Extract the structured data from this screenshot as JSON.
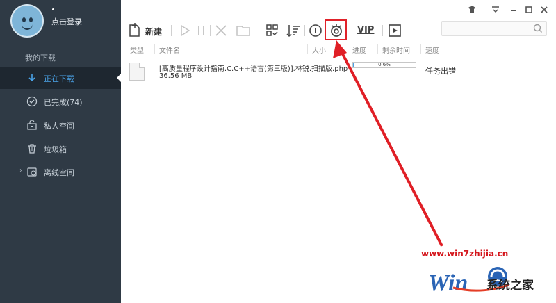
{
  "profile": {
    "login_label": "点击登录"
  },
  "sidebar": {
    "section_title": "我的下载",
    "items": [
      {
        "label": "正在下载",
        "icon": "download-arrow-icon",
        "active": true
      },
      {
        "label": "已完成(74)",
        "icon": "check-circle-icon",
        "active": false
      },
      {
        "label": "私人空间",
        "icon": "lock-box-icon",
        "active": false
      },
      {
        "label": "垃圾箱",
        "icon": "trash-icon",
        "active": false
      },
      {
        "label": "离线空间",
        "icon": "cloud-folder-icon",
        "active": false
      }
    ]
  },
  "toolbar": {
    "new_label": "新建",
    "vip_label": "VIP",
    "buttons": [
      "new-icon",
      "play-icon",
      "pause-icon",
      "delete-icon",
      "folder-icon",
      "grid-icon",
      "sort-icon",
      "speed-limit-icon",
      "settings-icon",
      "vip-icon",
      "media-play-icon"
    ]
  },
  "search": {
    "placeholder": ""
  },
  "columns": [
    "类型",
    "文件名",
    "大小",
    "进度",
    "剩余时间",
    "速度"
  ],
  "task": {
    "name": "[高质量程序设计指南.C.C++语言(第三版)].林锐.扫描版.php",
    "size": "36.56 MB",
    "progress_label": "0.6%",
    "progress": 0.006,
    "status": "任务出错"
  },
  "watermark": {
    "url": "www.win7zhijia.cn",
    "site": "系统之家"
  },
  "colors": {
    "accent": "#4aa3e8",
    "sidebar": "#2f3a45",
    "highlight": "#e0222a"
  }
}
